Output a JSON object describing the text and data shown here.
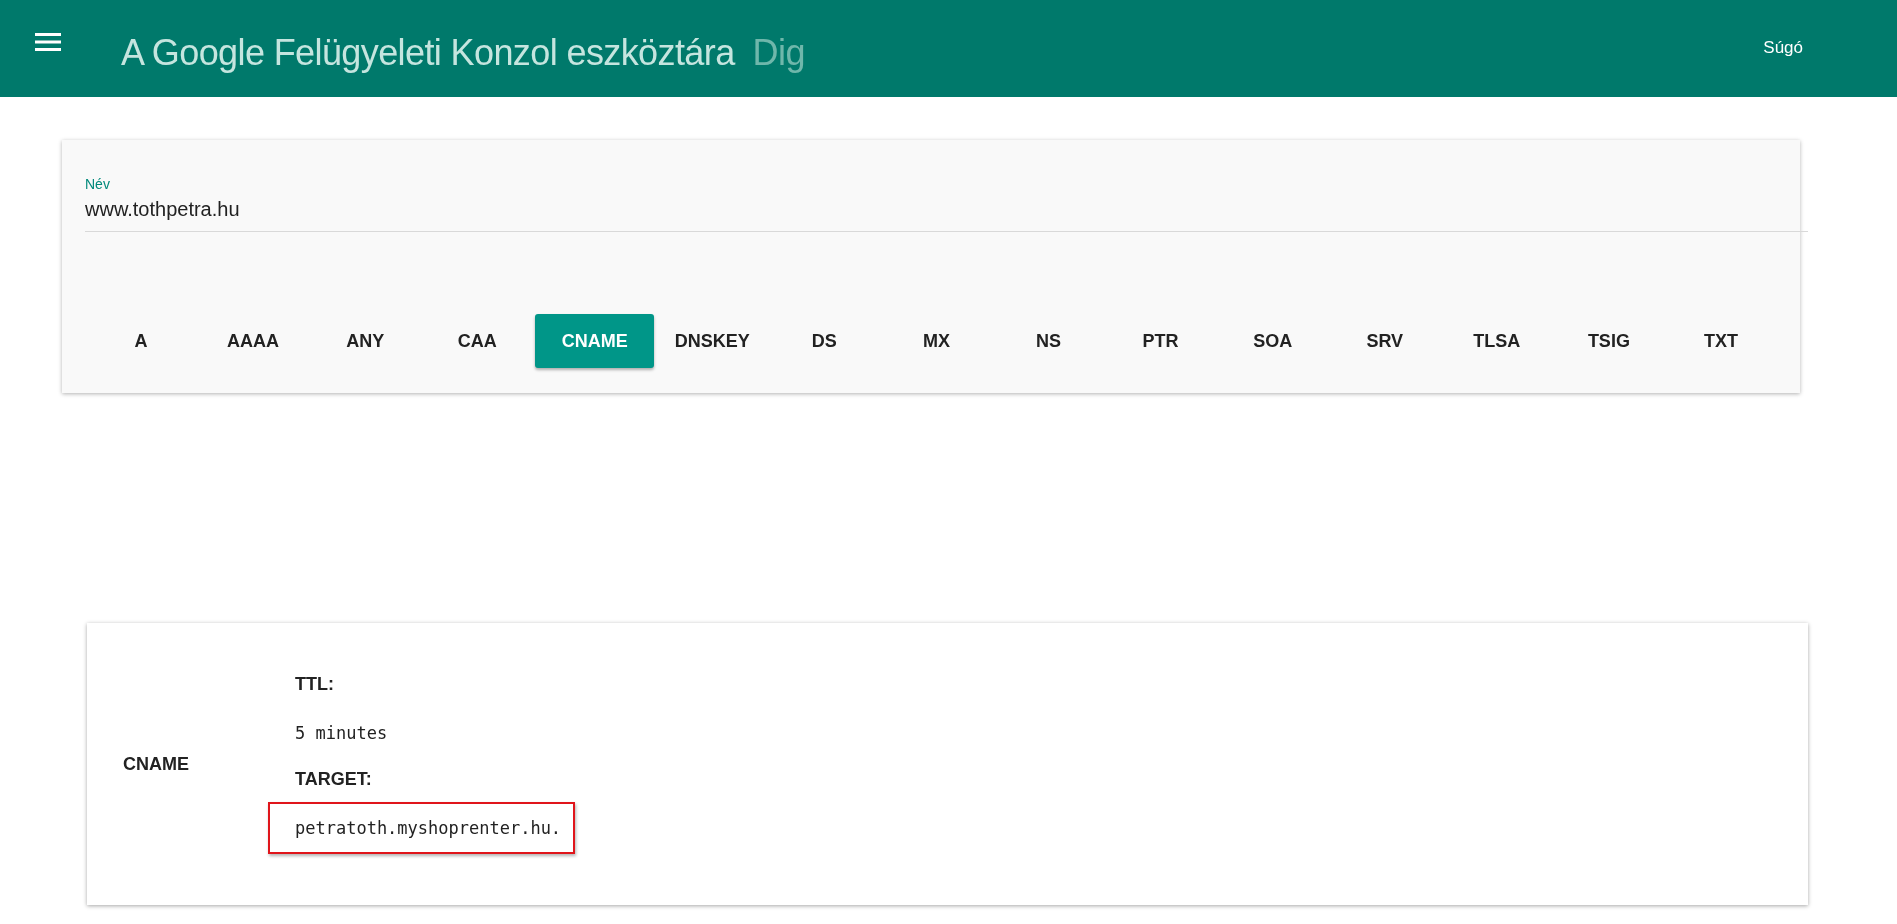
{
  "header": {
    "title": "A Google Felügyeleti Konzol eszköztára",
    "subtitle": "Dig",
    "help": "Súgó"
  },
  "name_field": {
    "label": "Név",
    "value": "www.tothpetra.hu"
  },
  "record_types": [
    {
      "label": "A",
      "selected": false
    },
    {
      "label": "AAAA",
      "selected": false
    },
    {
      "label": "ANY",
      "selected": false
    },
    {
      "label": "CAA",
      "selected": false
    },
    {
      "label": "CNAME",
      "selected": true
    },
    {
      "label": "DNSKEY",
      "selected": false
    },
    {
      "label": "DS",
      "selected": false
    },
    {
      "label": "MX",
      "selected": false
    },
    {
      "label": "NS",
      "selected": false
    },
    {
      "label": "PTR",
      "selected": false
    },
    {
      "label": "SOA",
      "selected": false
    },
    {
      "label": "SRV",
      "selected": false
    },
    {
      "label": "TLSA",
      "selected": false
    },
    {
      "label": "TSIG",
      "selected": false
    },
    {
      "label": "TXT",
      "selected": false
    }
  ],
  "result": {
    "type": "CNAME",
    "fields": [
      {
        "label": "TTL:",
        "value": "5 minutes",
        "highlighted": false
      },
      {
        "label": "TARGET:",
        "value": "petratoth.myshoprenter.hu.",
        "highlighted": true
      }
    ]
  }
}
